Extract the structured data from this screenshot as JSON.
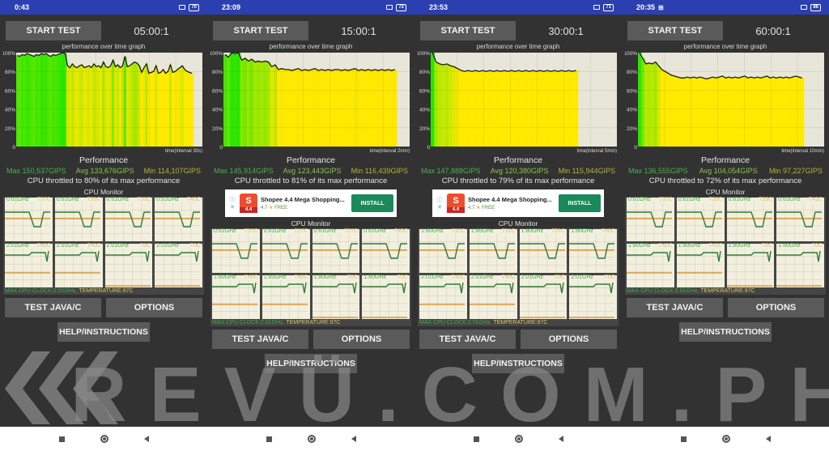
{
  "app": {
    "graph_title": "performance over time graph",
    "perf_title": "Performance",
    "cpu_title": "CPU Monitor",
    "start_label": "START TEST",
    "test_label": "TEST JAVA/C",
    "options_label": "OPTIONS",
    "help_label": "HELP/INSTRUCTIONS",
    "y_ticks": [
      "100%",
      "80%",
      "60%",
      "40%",
      "20%",
      "0"
    ]
  },
  "ad": {
    "name": "Shopee 4.4 Mega Shopping...",
    "rating": "4.7",
    "price": "FREE",
    "install_label": "INSTALL",
    "badge": "4.4",
    "info_icon": "info-icon",
    "close_icon": "close-icon"
  },
  "watermark": "REVÜ.COM.PH",
  "colors": {
    "statusbar": "#2b3fb0",
    "green": "#3fae43",
    "yellow_green": "#d4ff00",
    "yellow": "#ffeb00",
    "temp": "#d8c86a",
    "freq_line": "#2e7d32",
    "temp_line": "#d68a1a"
  },
  "screens": [
    {
      "time": "0:43",
      "battery": "70",
      "duration": "05:00:1",
      "interval_label": "time(interval 30s)",
      "max": "Max 150,537GIPS",
      "avg": "Avg 133,676GIPS",
      "min": "Min 114,107GIPS",
      "throttle": "CPU throttled to 80% of its max performance",
      "has_ad": false,
      "footer_clock": "MAX CPU CLOCK:2.01GHz,",
      "footer_temp": "TEMPERATURE:97C",
      "cores": [
        {
          "freq": "0.61GHz",
          "temp": "T37C"
        },
        {
          "freq": "0.61GHz",
          "temp": "T35C"
        },
        {
          "freq": "0.61GHz",
          "temp": "T35C"
        },
        {
          "freq": "0.61GHz",
          "temp": "T40C"
        },
        {
          "freq": "2.01GHz",
          "temp": "T40C"
        },
        {
          "freq": "2.01GHz",
          "temp": "T40C"
        },
        {
          "freq": "2.01GHz",
          "temp": "T0C"
        },
        {
          "freq": "2.01GHz",
          "temp": "T0C"
        }
      ],
      "perf_series": [
        97,
        96,
        98,
        97,
        99,
        98,
        97,
        96,
        98,
        97,
        99,
        98,
        99,
        97,
        96,
        98,
        97,
        98,
        99,
        100,
        99,
        86,
        84,
        88,
        85,
        84,
        86,
        87,
        84,
        85,
        86,
        84,
        88,
        85,
        86,
        84,
        90,
        85,
        84,
        86,
        92,
        85,
        87,
        84,
        86,
        96,
        85,
        86,
        88,
        90,
        89,
        86,
        79,
        84,
        88,
        78,
        79,
        80,
        86,
        78,
        79,
        82,
        78,
        80,
        87,
        79,
        80,
        82,
        84,
        86,
        82,
        80,
        79,
        78
      ],
      "fill_end": 0.95
    },
    {
      "time": "23:09",
      "battery": "72",
      "duration": "15:00:1",
      "interval_label": "time(interval 2min)",
      "max": "Max 145,914GIPS",
      "avg": "Avg 123,443GIPS",
      "min": "Min 116,439GIPS",
      "throttle": "CPU throttled to 81% of its max performance",
      "has_ad": true,
      "footer_clock": "MAX CPU CLOCK:2.01GHz,",
      "footer_temp": "TEMPERATURE:97C",
      "cores": [
        {
          "freq": "0.61GHz",
          "temp": "T37C"
        },
        {
          "freq": "0.61GHz",
          "temp": "T27C"
        },
        {
          "freq": "0.61GHz",
          "temp": "T27C"
        },
        {
          "freq": "0.61GHz",
          "temp": "T40C"
        },
        {
          "freq": "1.80GHz",
          "temp": "T40C"
        },
        {
          "freq": "1.80GHz",
          "temp": "T40C"
        },
        {
          "freq": "1.80GHz",
          "temp": "T0C"
        },
        {
          "freq": "1.80GHz",
          "temp": "T0C"
        }
      ],
      "perf_series": [
        98,
        95,
        100,
        99,
        100,
        92,
        94,
        91,
        93,
        90,
        91,
        90,
        91,
        90,
        85,
        87,
        82,
        83,
        82,
        82,
        81,
        82,
        83,
        81,
        82,
        81,
        82,
        83,
        81,
        82,
        81,
        82,
        81,
        82,
        82,
        81,
        82,
        81,
        82,
        83,
        81,
        82,
        81,
        82,
        81,
        82,
        81,
        82,
        81,
        82,
        81,
        82
      ],
      "fill_end": 0.93
    },
    {
      "time": "23:53",
      "battery": "71",
      "duration": "30:00:1",
      "interval_label": "time(interval 5min)",
      "max": "Max 147,888GIPS",
      "avg": "Avg 120,380GIPS",
      "min": "Min 115,944GIPS",
      "throttle": "CPU throttled to 79% of its max performance",
      "has_ad": true,
      "footer_clock": "MAX CPU CLOCK:2.01GHz,",
      "footer_temp": "TEMPERATURE:97C",
      "cores": [
        {
          "freq": "1.80GHz",
          "temp": "T37C"
        },
        {
          "freq": "1.80GHz",
          "temp": "T31C"
        },
        {
          "freq": "1.80GHz",
          "temp": "T31C"
        },
        {
          "freq": "1.80GHz",
          "temp": "T40C"
        },
        {
          "freq": "2.01GHz",
          "temp": "T40C"
        },
        {
          "freq": "2.01GHz",
          "temp": "T40C"
        },
        {
          "freq": "2.01GHz",
          "temp": "T0C"
        },
        {
          "freq": "2.01GHz",
          "temp": "T0C"
        }
      ],
      "perf_series": [
        100,
        90,
        88,
        87,
        88,
        86,
        85,
        83,
        81,
        80,
        81,
        80,
        81,
        80,
        81,
        80,
        81,
        80,
        81,
        80,
        81,
        80,
        81,
        80,
        81,
        80,
        81,
        80,
        81,
        80,
        81,
        80,
        81,
        80,
        81,
        80,
        81,
        80,
        81,
        80,
        81
      ],
      "fill_end": 0.79
    },
    {
      "time": "20:35",
      "battery": "86",
      "duration": "60:00:1",
      "interval_label": "time(interval 10min)",
      "max": "Max 136,555GIPS",
      "avg": "Avg 104,054GIPS",
      "min": "Min 97,227GIPS",
      "throttle": "CPU throttled to 72% of its max performance",
      "has_ad": false,
      "footer_clock": "MAX CPU CLOCK:2.01GHz,",
      "footer_temp": "TEMPERATURE:97C",
      "cores": [
        {
          "freq": "0.61GHz",
          "temp": "T37C"
        },
        {
          "freq": "0.61GHz",
          "temp": "T39C"
        },
        {
          "freq": "0.61GHz",
          "temp": "T39C"
        },
        {
          "freq": "0.61GHz",
          "temp": "T42C"
        },
        {
          "freq": "1.80GHz",
          "temp": "T42C"
        },
        {
          "freq": "1.80GHz",
          "temp": "T42C"
        },
        {
          "freq": "1.80GHz",
          "temp": "T0C"
        },
        {
          "freq": "1.80GHz",
          "temp": "T0C"
        }
      ],
      "perf_series": [
        100,
        94,
        88,
        89,
        88,
        90,
        86,
        82,
        80,
        78,
        76,
        75,
        74,
        73,
        73,
        74,
        73,
        74,
        73,
        74,
        73,
        72,
        73,
        74,
        73,
        74,
        75,
        73,
        74,
        73,
        74,
        73,
        74,
        75,
        73,
        74,
        73,
        74,
        73,
        74,
        75,
        73,
        74,
        73,
        74,
        73,
        74,
        73,
        74,
        75,
        74,
        73
      ],
      "fill_end": 0.89
    }
  ]
}
